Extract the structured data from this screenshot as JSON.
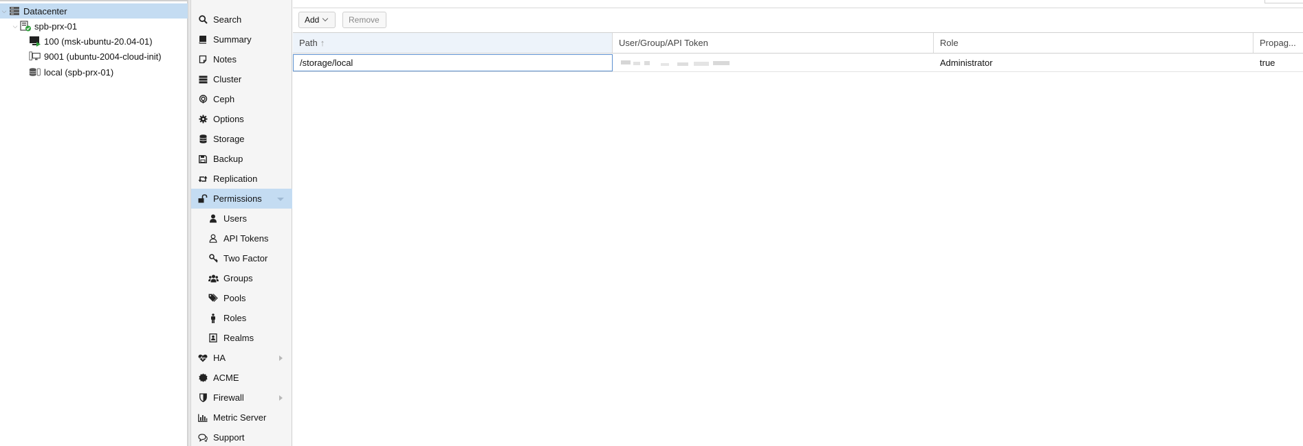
{
  "tree": {
    "items": [
      {
        "label": "Datacenter",
        "icon": "datacenter-icon"
      },
      {
        "label": "spb-prx-01",
        "icon": "node-online-icon"
      },
      {
        "label": "100 (msk-ubuntu-20.04-01)",
        "icon": "vm-running-icon"
      },
      {
        "label": "9001 (ubuntu-2004-cloud-init)",
        "icon": "vm-template-icon"
      },
      {
        "label": "local (spb-prx-01)",
        "icon": "storage-icon"
      }
    ]
  },
  "nav": {
    "items": [
      {
        "label": "Search",
        "icon": "search-icon"
      },
      {
        "label": "Summary",
        "icon": "book-icon"
      },
      {
        "label": "Notes",
        "icon": "notes-icon"
      },
      {
        "label": "Cluster",
        "icon": "server-icon"
      },
      {
        "label": "Ceph",
        "icon": "ceph-icon"
      },
      {
        "label": "Options",
        "icon": "gear-icon"
      },
      {
        "label": "Storage",
        "icon": "database-icon"
      },
      {
        "label": "Backup",
        "icon": "floppy-icon"
      },
      {
        "label": "Replication",
        "icon": "retweet-icon"
      },
      {
        "label": "Permissions",
        "icon": "unlock-icon"
      },
      {
        "label": "Users",
        "icon": "user-icon"
      },
      {
        "label": "API Tokens",
        "icon": "user-outline-icon"
      },
      {
        "label": "Two Factor",
        "icon": "key-icon"
      },
      {
        "label": "Groups",
        "icon": "users-icon"
      },
      {
        "label": "Pools",
        "icon": "tags-icon"
      },
      {
        "label": "Roles",
        "icon": "male-icon"
      },
      {
        "label": "Realms",
        "icon": "address-book-icon"
      },
      {
        "label": "HA",
        "icon": "heartbeat-icon"
      },
      {
        "label": "ACME",
        "icon": "certificate-icon"
      },
      {
        "label": "Firewall",
        "icon": "shield-icon"
      },
      {
        "label": "Metric Server",
        "icon": "bar-chart-icon"
      },
      {
        "label": "Support",
        "icon": "comments-icon"
      }
    ]
  },
  "toolbar": {
    "add_label": "Add",
    "remove_label": "Remove"
  },
  "grid": {
    "columns": [
      "Path",
      "User/Group/API Token",
      "Role",
      "Propag..."
    ],
    "rows": [
      {
        "path": "/storage/local",
        "user": "",
        "role": "Administrator",
        "propagate": "true"
      }
    ]
  },
  "colors": {
    "selection": "#c4dcf2",
    "focus_border": "#5a8fcf",
    "running": "#2e9e3a"
  }
}
